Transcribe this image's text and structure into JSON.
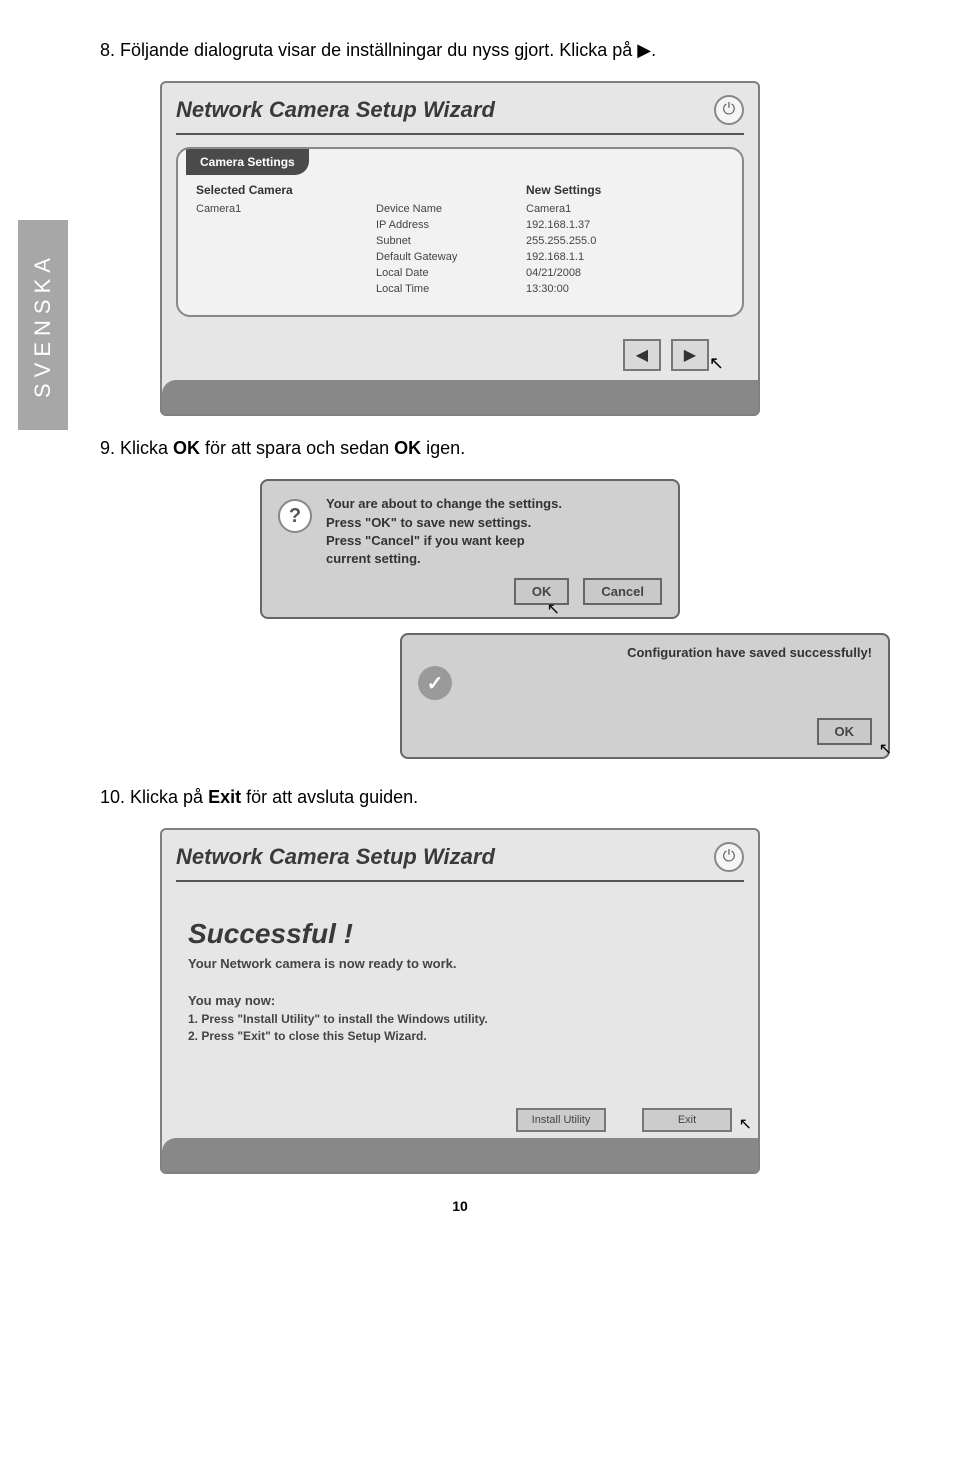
{
  "sidebar": {
    "language": "SVENSKA"
  },
  "steps": {
    "s8": "8.  Följande dialogruta visar de inställningar du nyss gjort. Klicka på ▶.",
    "s9_a": "9.  Klicka ",
    "s9_b": " för att spara och sedan ",
    "s9_c": " igen.",
    "s9_ok": "OK",
    "s10_a": "10. Klicka på ",
    "s10_b": " för att avsluta guiden.",
    "s10_exit": "Exit"
  },
  "wizard1": {
    "title": "Network Camera Setup Wizard",
    "panel_title": "Camera Settings",
    "col1": "Selected Camera",
    "col2": "New Settings",
    "camera": "Camera1",
    "rows": [
      {
        "label": "Device Name",
        "value": "Camera1"
      },
      {
        "label": "IP Address",
        "value": "192.168.1.37"
      },
      {
        "label": "Subnet",
        "value": "255.255.255.0"
      },
      {
        "label": "Default Gateway",
        "value": "192.168.1.1"
      },
      {
        "label": "Local Date",
        "value": "04/21/2008"
      },
      {
        "label": "Local Time",
        "value": "13:30:00"
      }
    ],
    "nav_prev": "◀",
    "nav_next": "▶"
  },
  "confirm": {
    "line1": "Your are about to change the settings.",
    "line2": "Press \"OK\" to save new settings.",
    "line3": "Press \"Cancel\" if you want keep",
    "line4": "current setting.",
    "ok": "OK",
    "cancel": "Cancel"
  },
  "saved": {
    "text": "Configuration have saved successfully!",
    "ok": "OK"
  },
  "wizard2": {
    "title": "Network Camera Setup Wizard",
    "h": "Successful !",
    "sub": "Your Network camera is now ready to work.",
    "p": "You may now:",
    "li1": "1. Press \"Install Utility\" to install the Windows utility.",
    "li2": "2. Press \"Exit\" to close this Setup Wizard.",
    "btn_install": "Install Utility",
    "btn_exit": "Exit"
  },
  "page": "10",
  "cursor_glyph": "↖"
}
